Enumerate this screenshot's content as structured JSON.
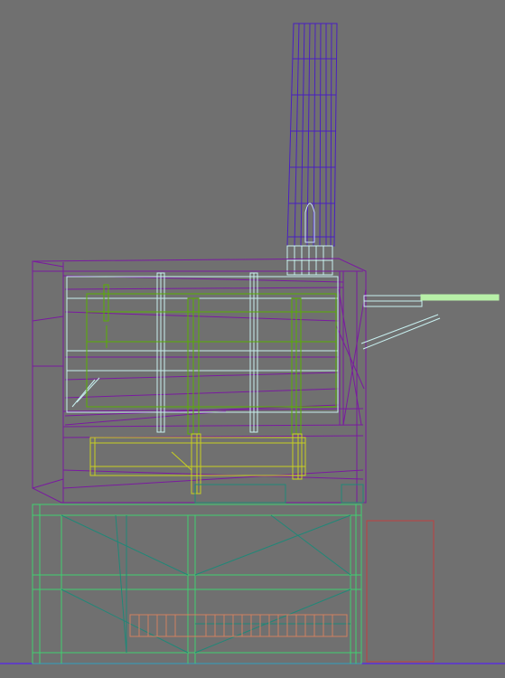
{
  "viewport": {
    "background": "#707070",
    "view": "wireframe-side"
  },
  "palette": {
    "chimney": "#4a20c0",
    "housing": "#7a1aa0",
    "frame_light": "#c8f0f0",
    "frame_green": "#58b000",
    "frame_yellow": "#c8d020",
    "base_green": "#40d070",
    "base_teal": "#208878",
    "outline_red": "#c04040",
    "pipe_green": "#b8f0a8",
    "ground": "#6040c0"
  },
  "layers": [
    {
      "name": "chimney-stack",
      "color": "#4a20c0",
      "visible": true
    },
    {
      "name": "boiler-housing",
      "color": "#7a1aa0",
      "visible": true
    },
    {
      "name": "internal-frame",
      "color": "#c8f0f0",
      "visible": true
    },
    {
      "name": "support-base",
      "color": "#40d070",
      "visible": true
    },
    {
      "name": "red-outline",
      "color": "#c04040",
      "visible": true
    }
  ]
}
